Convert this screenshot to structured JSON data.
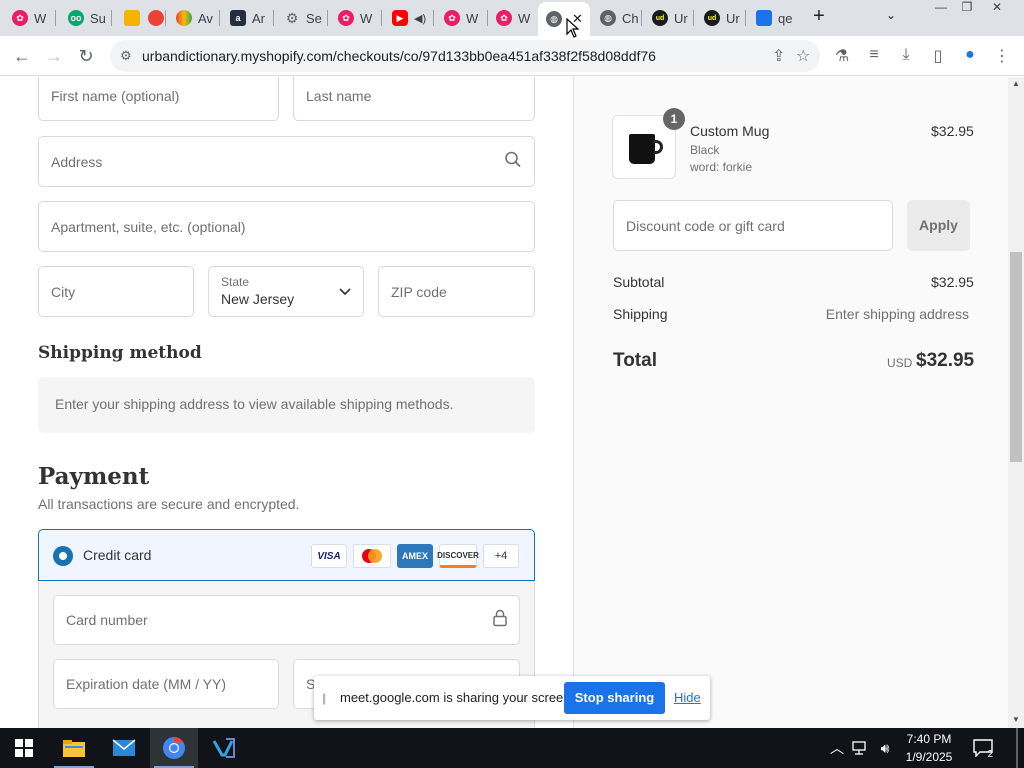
{
  "browser": {
    "tabs": [
      {
        "label": "W",
        "icon": "flower-icon",
        "color": "#e91e63"
      },
      {
        "label": "Su",
        "icon": "tripadvisor-icon",
        "color": "#00aa6c"
      },
      {
        "label": "",
        "icon": "drive-icon",
        "color": "#f4b400"
      },
      {
        "label": "",
        "icon": "record-icon",
        "color": "#ea4335"
      },
      {
        "label": "Av",
        "icon": "rainbow-icon",
        "color": "#ff9800"
      },
      {
        "label": "Ar",
        "icon": "amazon-icon",
        "color": "#232f3e"
      },
      {
        "label": "Se",
        "icon": "gear-icon",
        "color": "#5f6368"
      },
      {
        "label": "W",
        "icon": "flower-icon",
        "color": "#e91e63"
      },
      {
        "label": "",
        "icon": "youtube-icon",
        "color": "#ff0000"
      },
      {
        "label": "W",
        "icon": "flower-icon",
        "color": "#e91e63"
      },
      {
        "label": "W",
        "icon": "flower-icon",
        "color": "#e91e63"
      },
      {
        "label": "",
        "icon": "globe-icon",
        "color": "#5f6368"
      },
      {
        "label": "Ch",
        "icon": "globe-icon",
        "color": "#5f6368"
      },
      {
        "label": "Ur",
        "icon": "ud-icon",
        "color": "#1b1b1b"
      },
      {
        "label": "Ur",
        "icon": "ud-icon",
        "color": "#1b1b1b"
      },
      {
        "label": "qe",
        "icon": "app-icon",
        "color": "#1a73e8"
      }
    ],
    "url": "urbandictionary.myshopify.com/checkouts/co/97d133bb0ea451af338f2f58d08ddf76"
  },
  "form": {
    "first_name_placeholder": "First name (optional)",
    "last_name_placeholder": "Last name",
    "address_placeholder": "Address",
    "apartment_placeholder": "Apartment, suite, etc. (optional)",
    "city_placeholder": "City",
    "state_label": "State",
    "state_value": "New Jersey",
    "zip_placeholder": "ZIP code"
  },
  "shipping": {
    "heading": "Shipping method",
    "note": "Enter your shipping address to view available shipping methods."
  },
  "payment": {
    "heading": "Payment",
    "subtitle": "All transactions are secure and encrypted.",
    "method_label": "Credit card",
    "cards": [
      "VISA",
      "",
      "AMEX",
      "DISCOVER",
      "+4"
    ],
    "card_number_placeholder": "Card number",
    "expiration_placeholder": "Expiration date (MM / YY)",
    "security_placeholder": "S",
    "accent_color": "#1773b0"
  },
  "summary": {
    "quantity": "1",
    "product_name": "Custom Mug",
    "variant_color": "Black",
    "variant_word": "word: forkie",
    "product_price": "$32.95",
    "discount_placeholder": "Discount code or gift card",
    "apply_label": "Apply",
    "subtotal_label": "Subtotal",
    "subtotal_value": "$32.95",
    "shipping_label": "Shipping",
    "shipping_value": "Enter shipping address",
    "total_label": "Total",
    "currency": "USD",
    "total_value": "$32.95"
  },
  "share_banner": {
    "message": "meet.google.com is sharing your screen.",
    "stop_label": "Stop sharing",
    "hide_label": "Hide"
  },
  "taskbar": {
    "time": "7:40 PM",
    "date": "1/9/2025",
    "notifications": "2"
  }
}
